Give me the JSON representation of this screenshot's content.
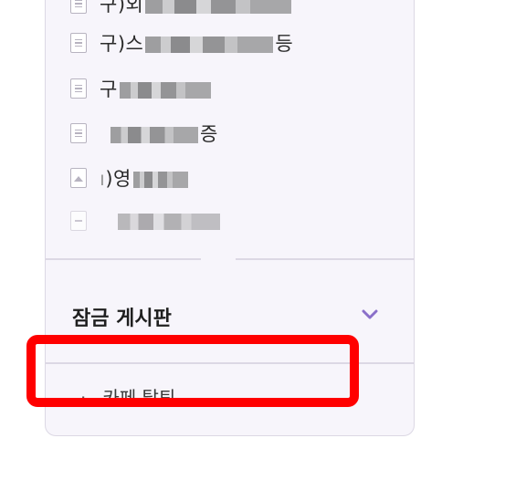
{
  "boards": [
    {
      "icon": "document-icon",
      "label_visible": "구)외",
      "redacted": true
    },
    {
      "icon": "document-icon",
      "label_visible": "구)스",
      "label_suffix": "등",
      "redacted": true
    },
    {
      "icon": "document-icon",
      "label_visible": "구",
      "redacted": true
    },
    {
      "icon": "document-icon",
      "label_visible": "",
      "label_suffix": "증",
      "redacted": true
    },
    {
      "icon": "image-icon",
      "label_visible": ")영",
      "redacted": true
    },
    {
      "icon": "document-icon",
      "label_visible": "",
      "redacted": true
    }
  ],
  "locked_section": {
    "title": "잠금 게시판",
    "chevron_icon": "chevron-down-icon",
    "chevron_color": "#8a6fc9"
  },
  "leave_cafe": {
    "bullet": "·",
    "label": "카페 탈퇴"
  },
  "colors": {
    "panel_bg": "#f7f5fb",
    "border": "#dcd8e4",
    "highlight": "#ff0000"
  }
}
